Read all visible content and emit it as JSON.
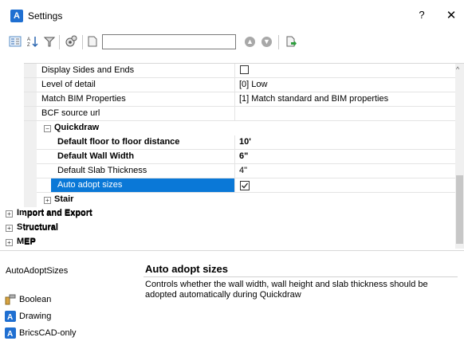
{
  "window": {
    "title": "Settings",
    "help_label": "?",
    "close_label": "✕"
  },
  "toolbar": {
    "search_value": ""
  },
  "grid": {
    "rows": [
      {
        "name": "Display Sides and Ends",
        "value": ""
      },
      {
        "name": "Level of detail",
        "value": "[0] Low"
      },
      {
        "name": "Match BIM Properties",
        "value": "[1] Match standard and BIM properties"
      },
      {
        "name": "BCF source url",
        "value": ""
      }
    ],
    "quickdraw": {
      "label": "Quickdraw",
      "rows": [
        {
          "name": "Default floor to floor distance",
          "value": "10'"
        },
        {
          "name": "Default Wall Width",
          "value": "6\""
        },
        {
          "name": "Default Slab Thickness",
          "value": "4\""
        },
        {
          "name": "Auto adopt sizes",
          "value": ""
        }
      ]
    },
    "categories": [
      "Stair",
      "Import and Export",
      "Structural",
      "MEP"
    ]
  },
  "description": {
    "key": "AutoAdoptSizes",
    "title": "Auto adopt sizes",
    "text": "Controls whether the wall width, wall height and slab thickness should be adopted automatically during Quickdraw",
    "info": [
      "Boolean",
      "Drawing",
      "BricsCAD-only"
    ]
  },
  "colors": {
    "selection": "#0a78d7",
    "app_icon": "#1f6fd1"
  }
}
